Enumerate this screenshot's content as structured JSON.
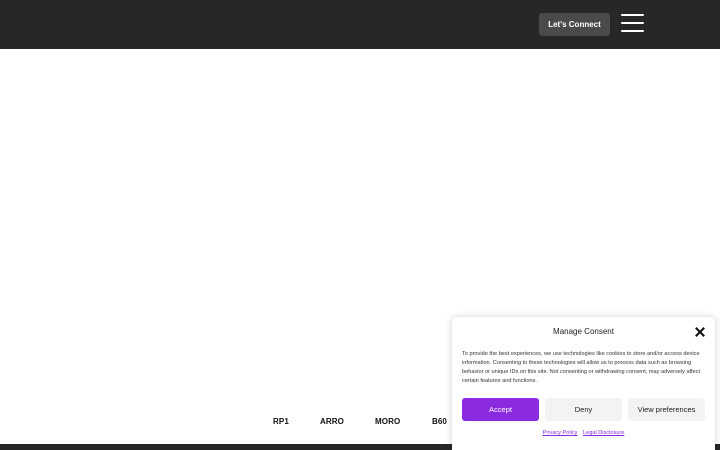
{
  "header": {
    "connect_label": "Let's Connect",
    "menu_icon": "hamburger-menu-icon"
  },
  "brands": [
    "RP1",
    "ARRO",
    "MORO",
    "B60"
  ],
  "consent": {
    "title": "Manage Consent",
    "close_icon": "close-icon",
    "body": "To provide the best experiences, we use technologies like cookies to store and/or access device information. Consenting to these technologies will allow us to process data such as browsing behavior or unique IDs on this site. Not consenting or withdrawing consent, may adversely affect certain features and functions.",
    "accept_label": "Accept",
    "deny_label": "Deny",
    "preferences_label": "View preferences",
    "privacy_link": "Privacy Policy",
    "legal_link": "Legal Disclosure"
  },
  "colors": {
    "header_bg": "#272727",
    "accent": "#8a2be2",
    "button_dark": "#4a4a4a"
  }
}
